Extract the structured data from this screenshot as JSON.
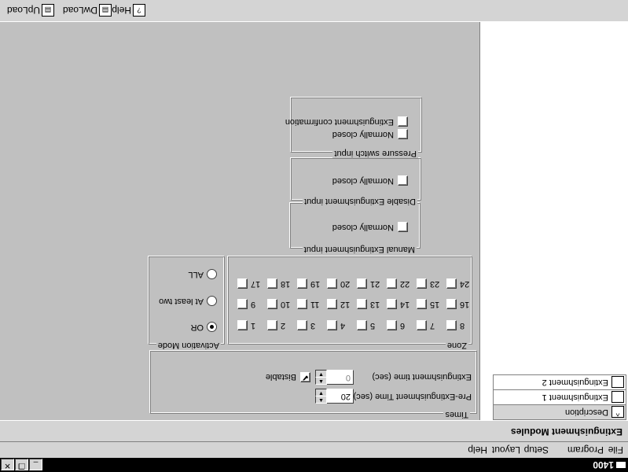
{
  "window": {
    "title": "1400",
    "minimize_glyph": "_",
    "restore_glyph": "❐",
    "close_glyph": "✕"
  },
  "menu": {
    "file": "File",
    "program": "Program",
    "setup": "Setup",
    "layout": "Layout",
    "help": "Help"
  },
  "section_title": "Extinguishment Modules",
  "module_list": {
    "header": "Description",
    "header_icon": "sort-arrow-icon",
    "items": [
      {
        "label": "Extinguishment 1"
      },
      {
        "label": "Extinguishment 2"
      }
    ]
  },
  "times": {
    "group_title": "Times",
    "pre_label": "Pre-Extinguishment Time (sec)",
    "pre_value": "20",
    "ext_label": "Extinguishment time (sec)",
    "ext_value": "0",
    "bistable_label": "Bistable",
    "bistable_checked": true
  },
  "zone": {
    "group_title": "Zone",
    "rows": [
      [
        "1",
        "2",
        "3",
        "4",
        "5",
        "6",
        "7",
        "8"
      ],
      [
        "9",
        "10",
        "11",
        "12",
        "13",
        "14",
        "15",
        "16"
      ],
      [
        "17",
        "18",
        "19",
        "20",
        "21",
        "22",
        "23",
        "24"
      ]
    ]
  },
  "activation_mode": {
    "group_title": "Activation Mode",
    "options": [
      "OR",
      "At least two",
      "ALL"
    ],
    "selected": "OR"
  },
  "manual_input": {
    "group_title": "Manual Extinguishment input",
    "option": "Normally closed"
  },
  "disable_input": {
    "group_title": "Disable Extinguishment input",
    "option": "Normally closed"
  },
  "pressure_input": {
    "group_title": "Pressure switch input",
    "options": [
      "Normally closed",
      "Extinguishment confirmation"
    ]
  },
  "toolbar": {
    "upload": "UpLoad",
    "dwload": "DwLoad",
    "help": "Help"
  },
  "icons": {
    "upload": "upload-icon",
    "dwload": "download-icon",
    "help": "help-icon"
  }
}
